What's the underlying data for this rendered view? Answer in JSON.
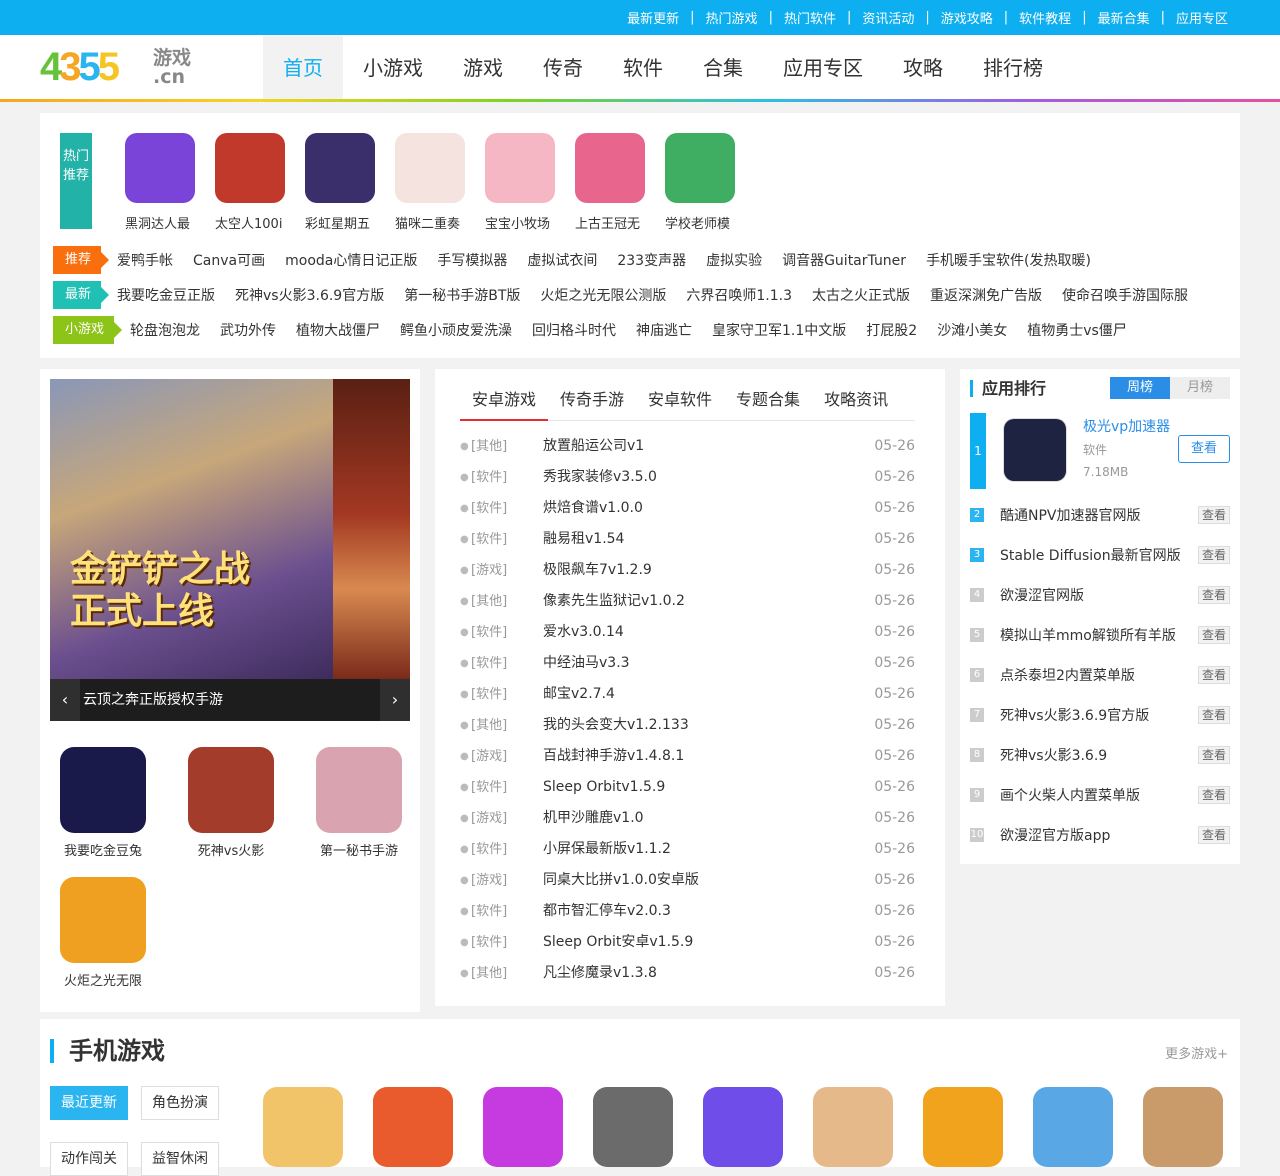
{
  "toplinks": [
    "最新更新",
    "热门游戏",
    "热门软件",
    "资讯活动",
    "游戏攻略",
    "软件教程",
    "最新合集",
    "应用专区"
  ],
  "logo": {
    "digits": [
      "4",
      "3",
      "5",
      "5"
    ],
    "suffix": "游戏",
    "domain": ".cn"
  },
  "nav": [
    "首页",
    "小游戏",
    "游戏",
    "传奇",
    "软件",
    "合集",
    "应用专区",
    "攻略",
    "排行榜"
  ],
  "hot": {
    "label": "热门推荐",
    "items": [
      {
        "name": "黑洞达人最",
        "color": "#7a44d8"
      },
      {
        "name": "太空人100i",
        "color": "#c0392b"
      },
      {
        "name": "彩虹星期五",
        "color": "#3b2f6b"
      },
      {
        "name": "猫咪二重奏",
        "color": "#f4e3de"
      },
      {
        "name": "宝宝小牧场",
        "color": "#f6b7c4"
      },
      {
        "name": "上古王冠无",
        "color": "#e8658e"
      },
      {
        "name": "学校老师模",
        "color": "#3fae62"
      }
    ]
  },
  "tagrows": [
    {
      "tag": "推荐",
      "links": [
        "爱鸭手帐",
        "Canva可画",
        "mooda心情日记正版",
        "手写模拟器",
        "虚拟试衣间",
        "233变声器",
        "虚拟实验",
        "调音器GuitarTuner",
        "手机暖手宝软件(发热取暖)"
      ]
    },
    {
      "tag": "最新",
      "links": [
        "我要吃金豆正版",
        "死神vs火影3.6.9官方版",
        "第一秘书手游BT版",
        "火炬之光无限公测版",
        "六界召唤师1.1.3",
        "太古之火正式版",
        "重返深渊免广告版",
        "使命召唤手游国际服"
      ]
    },
    {
      "tag": "小游戏",
      "links": [
        "轮盘泡泡龙",
        "武功外传",
        "植物大战僵尸",
        "鳄鱼小顽皮爱洗澡",
        "回归格斗时代",
        "神庙逃亡",
        "皇家守卫军1.1中文版",
        "打屁股2",
        "沙滩小美女",
        "植物勇士vs僵尸"
      ]
    }
  ],
  "banner": {
    "caption": "云顶之奔正版授权手游",
    "promo_line1": "金铲铲之战",
    "promo_line2": "正式上线",
    "prev": "‹",
    "next": "›"
  },
  "featured": [
    {
      "name": "我要吃金豆兔",
      "color": "#1a1a4a"
    },
    {
      "name": "死神vs火影",
      "color": "#a33c2a"
    },
    {
      "name": "第一秘书手游",
      "color": "#d9a3b0"
    },
    {
      "name": "火炬之光无限",
      "color": "#f0a020"
    }
  ],
  "news": {
    "tabs": [
      "安卓游戏",
      "传奇手游",
      "安卓软件",
      "专题合集",
      "攻略资讯"
    ],
    "rows": [
      {
        "cat": "[其他]",
        "title": "放置船运公司v1",
        "date": "05-26"
      },
      {
        "cat": "[软件]",
        "title": "秀我家装修v3.5.0",
        "date": "05-26"
      },
      {
        "cat": "[软件]",
        "title": "烘焙食谱v1.0.0",
        "date": "05-26"
      },
      {
        "cat": "[软件]",
        "title": "融易租v1.54",
        "date": "05-26"
      },
      {
        "cat": "[游戏]",
        "title": "极限飙车7v1.2.9",
        "date": "05-26"
      },
      {
        "cat": "[其他]",
        "title": "像素先生监狱记v1.0.2",
        "date": "05-26"
      },
      {
        "cat": "[软件]",
        "title": "爱水v3.0.14",
        "date": "05-26"
      },
      {
        "cat": "[软件]",
        "title": "中经油马v3.3",
        "date": "05-26"
      },
      {
        "cat": "[软件]",
        "title": "邮宝v2.7.4",
        "date": "05-26"
      },
      {
        "cat": "[其他]",
        "title": "我的头会变大v1.2.133",
        "date": "05-26"
      },
      {
        "cat": "[游戏]",
        "title": "百战封神手游v1.4.8.1",
        "date": "05-26"
      },
      {
        "cat": "[软件]",
        "title": "Sleep Orbitv1.5.9",
        "date": "05-26"
      },
      {
        "cat": "[游戏]",
        "title": "机甲沙雕鹿v1.0",
        "date": "05-26"
      },
      {
        "cat": "[软件]",
        "title": "小屏保最新版v1.1.2",
        "date": "05-26"
      },
      {
        "cat": "[游戏]",
        "title": "同桌大比拼v1.0.0安卓版",
        "date": "05-26"
      },
      {
        "cat": "[软件]",
        "title": "都市智汇停车v2.0.3",
        "date": "05-26"
      },
      {
        "cat": "[软件]",
        "title": "Sleep Orbit安卓v1.5.9",
        "date": "05-26"
      },
      {
        "cat": "[其他]",
        "title": "凡尘修魔录v1.3.8",
        "date": "05-26"
      }
    ]
  },
  "ranking": {
    "title": "应用排行",
    "tab_week": "周榜",
    "tab_month": "月榜",
    "first": {
      "rank": "1",
      "name": "极光vp加速器",
      "category": "软件",
      "size": "7.18MB",
      "button": "查看"
    },
    "rows": [
      {
        "rank": "2",
        "name": "酷通NPV加速器官网版",
        "button": "查看"
      },
      {
        "rank": "3",
        "name": "Stable Diffusion最新官网版",
        "button": "查看"
      },
      {
        "rank": "4",
        "name": "欲漫涩官网版",
        "button": "查看"
      },
      {
        "rank": "5",
        "name": "模拟山羊mmo解锁所有羊版",
        "button": "查看"
      },
      {
        "rank": "6",
        "name": "点杀泰坦2内置菜单版",
        "button": "查看"
      },
      {
        "rank": "7",
        "name": "死神vs火影3.6.9官方版",
        "button": "查看"
      },
      {
        "rank": "8",
        "name": "死神vs火影3.6.9",
        "button": "查看"
      },
      {
        "rank": "9",
        "name": "画个火柴人内置菜单版",
        "button": "查看"
      },
      {
        "rank": "10",
        "name": "欲漫涩官方版app",
        "button": "查看"
      }
    ]
  },
  "mobile": {
    "title": "手机游戏",
    "more": "更多游戏+",
    "cats": [
      "最近更新",
      "角色扮演",
      "动作闯关",
      "益智休闲"
    ],
    "icons": [
      "#f2c46a",
      "#e95b2c",
      "#c63be0",
      "#6b6b6b",
      "#6e4de8",
      "#e6b98a",
      "#f2a31d",
      "#5aa7e6",
      "#c99a6a"
    ]
  }
}
